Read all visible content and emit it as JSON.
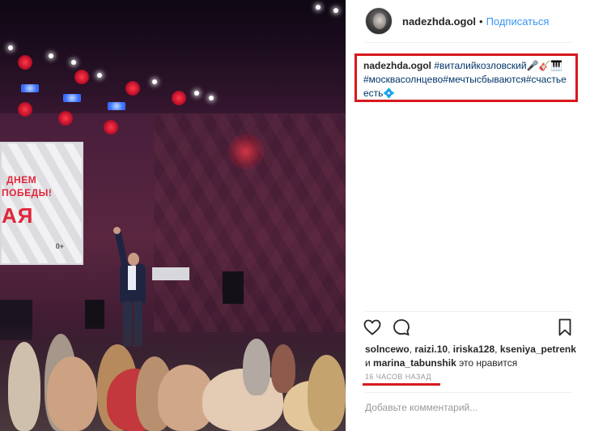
{
  "post": {
    "username": "nadezhda.ogol",
    "follow_label": "Подписаться",
    "dot": "•"
  },
  "caption": {
    "username": "nadezhda.ogol",
    "hashtag1": "#виталийкозловский",
    "emoji1": "🎤🎸🎹",
    "hashtag2": "#москвасолнцево",
    "hashtag3": "#мечтысбываются",
    "hashtag4": "#счастьеесть",
    "emoji2": "💠"
  },
  "actions": {
    "like_icon": "heart-icon",
    "comment_icon": "speech-bubble-icon",
    "save_icon": "bookmark-icon"
  },
  "likes": {
    "users": [
      "solncewo",
      "raizi.10",
      "iriska128",
      "kseniya_petrenk",
      "marina_tabunshik"
    ],
    "separator": ",",
    "and_label": "и",
    "suffix": "это нравится"
  },
  "timestamp": "16 ЧАСОВ НАЗАД",
  "comment": {
    "placeholder": "Добавьте комментарий..."
  },
  "photo": {
    "screen_line1": "ДНЕМ",
    "screen_line2": "ПОБЕДЫ!",
    "screen_big": "АЯ",
    "screen_age": "0+"
  },
  "colors": {
    "accent_link": "#3897f0",
    "hashtag": "#003569",
    "annotation_red": "#d7191f",
    "muted": "#999999"
  }
}
